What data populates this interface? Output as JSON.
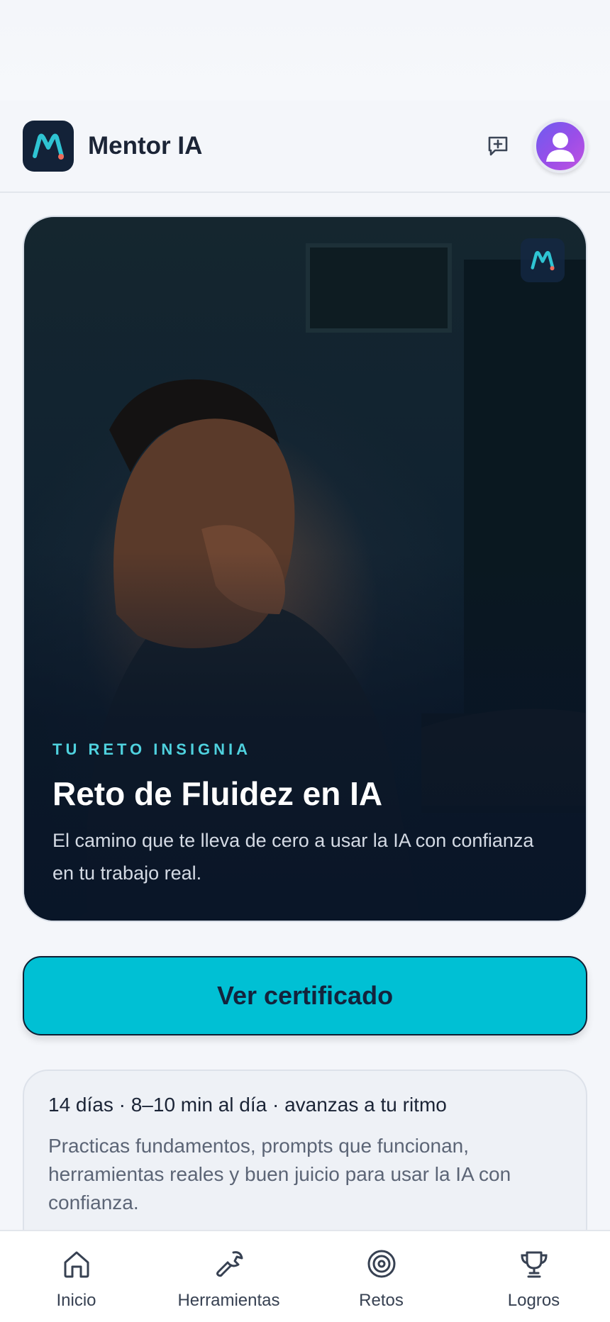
{
  "app": {
    "title": "Mentor IA"
  },
  "header": {
    "logo_icon": "mentor-logo-icon",
    "new_chat_icon": "message-plus-icon",
    "avatar_icon": "user-avatar-icon"
  },
  "hero": {
    "eyebrow": "TU RETO INSIGNIA",
    "title": "Reto de Fluidez en IA",
    "description": "El camino que te lleva de cero a usar la IA con confianza en tu trabajo real."
  },
  "cta": {
    "label": "Ver certificado",
    "color": "#00c0d4"
  },
  "info": {
    "meta": "14 días · 8–10 min al día · avanzas a tu ritmo",
    "description": "Practicas fundamentos, prompts que funcionan, herramientas reales y buen juicio para usar la IA con confianza."
  },
  "nav": {
    "items": [
      {
        "label": "Inicio",
        "icon": "home-icon"
      },
      {
        "label": "Herramientas",
        "icon": "wrench-icon"
      },
      {
        "label": "Retos",
        "icon": "target-icon"
      },
      {
        "label": "Logros",
        "icon": "trophy-icon"
      }
    ]
  },
  "colors": {
    "accent": "#00c0d4",
    "brand_dark": "#132238",
    "logo_dot": "#f06b5a"
  }
}
